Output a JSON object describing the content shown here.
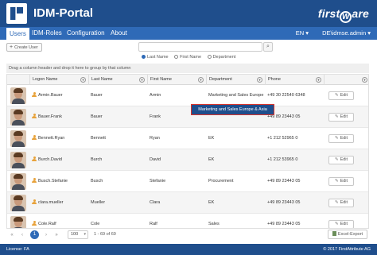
{
  "header": {
    "title": "IDM-Portal",
    "brand_prefix": "first",
    "brand_ring": "W",
    "brand_suffix": "are"
  },
  "nav": {
    "items": [
      {
        "label": "Users",
        "active": true
      },
      {
        "label": "IDM-Roles",
        "active": false
      },
      {
        "label": "Configuration",
        "active": false
      },
      {
        "label": "About",
        "active": false
      }
    ],
    "language": "EN",
    "language_caret": "▾",
    "user": "DE\\idmse.admin",
    "user_caret": "▾"
  },
  "toolbar": {
    "create_label": "Create User",
    "create_icon": "+",
    "search_value": "",
    "search_icon": "⌕",
    "radios": [
      {
        "label": "Last Name",
        "selected": true
      },
      {
        "label": "First Name",
        "selected": false
      },
      {
        "label": "Department",
        "selected": false
      }
    ]
  },
  "group_bar": {
    "text": "Drag a column header and drop it here to group by that column"
  },
  "grid": {
    "columns": [
      "Logon Name",
      "Last Name",
      "First Name",
      "Department",
      "Phone"
    ],
    "filter_icon": "▾",
    "edit_label": "Edit",
    "edit_icon": "✎",
    "rows": [
      {
        "logon": "Armin.Bauer",
        "last": "Bauer",
        "first": "Armin",
        "department": "Marketing and Sales Europe ...",
        "phone": "+49 30 22540 6348"
      },
      {
        "logon": "Bauer.Frank",
        "last": "Bauer",
        "first": "Frank",
        "department": "",
        "phone": "+49 89 23443 05"
      },
      {
        "logon": "Bennett.Ryan",
        "last": "Bennett",
        "first": "Ryan",
        "department": "EK",
        "phone": "+1 212 52965 0"
      },
      {
        "logon": "Burch.David",
        "last": "Burch",
        "first": "David",
        "department": "EK",
        "phone": "+1 212 53965 0"
      },
      {
        "logon": "Busch.Stefanie",
        "last": "Busch",
        "first": "Stefanie",
        "department": "Procurement",
        "phone": "+49 89 23443 05"
      },
      {
        "logon": "clara.mueller",
        "last": "Mueller",
        "first": "Clara",
        "department": "EK",
        "phone": "+49 89 23443 05"
      },
      {
        "logon": "Cole.Ralf",
        "last": "Cole",
        "first": "Ralf",
        "department": "Sales",
        "phone": "+49 89 23443 05"
      }
    ]
  },
  "tooltip": {
    "text": "Marketing and Sales Europe & Asia"
  },
  "pager": {
    "first": "«",
    "prev": "‹",
    "page": "1",
    "next": "›",
    "last": "»",
    "page_size": "100",
    "page_size_caret": "▾",
    "info": "1 - 69 of 69 ",
    "excel_label": "Excel-Export"
  },
  "footer": {
    "license": "License: FA",
    "copyright": "© 2017 FirstAttribute AG"
  },
  "colors": {
    "header_bg": "#1f4e8c",
    "nav_bg": "#2f6ab7",
    "accent": "#2f6ab7",
    "user_icon": "#e8a23a",
    "tooltip_border": "#d9342b"
  }
}
